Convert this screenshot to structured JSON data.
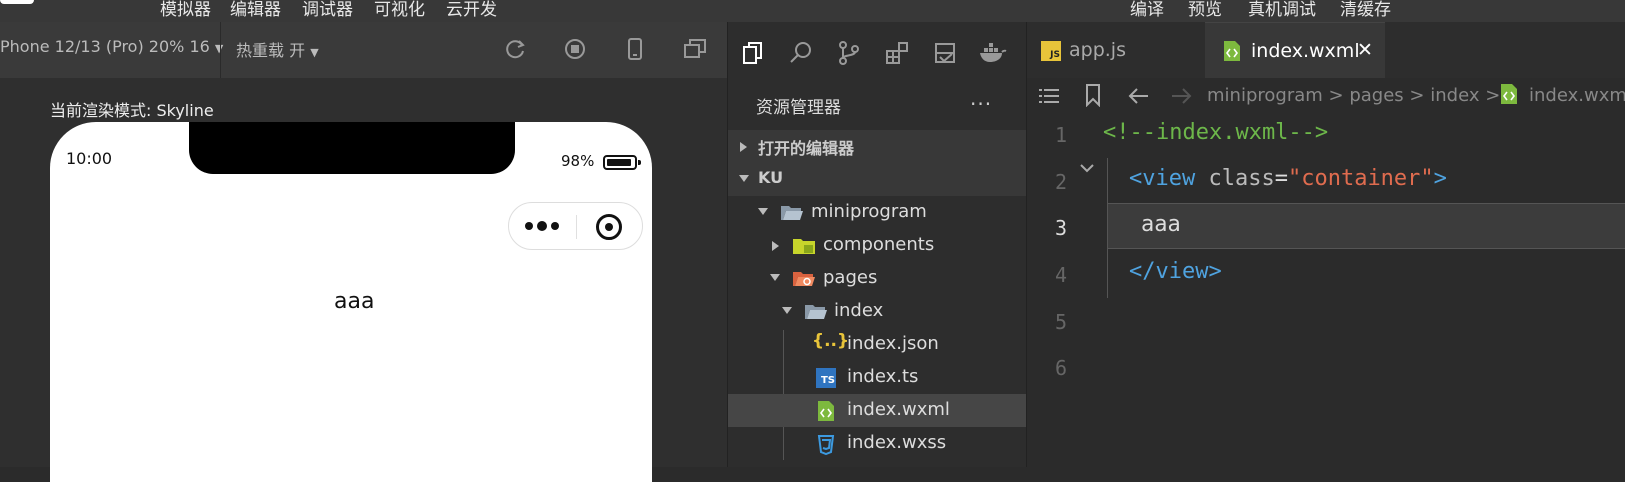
{
  "menubar": {
    "left_items": [
      "模拟器",
      "编辑器",
      "调试器",
      "可视化",
      "云开发"
    ],
    "right_items": [
      "编译",
      "预览",
      "真机调试",
      "清缓存"
    ]
  },
  "simulator_toolbar": {
    "device": "Phone 12/13 (Pro) 20% 16",
    "hot_reload": "热重载 开"
  },
  "render_mode": "当前渲染模式: Skyline",
  "phone": {
    "time": "10:00",
    "battery": "98%",
    "content": "aaa"
  },
  "explorer": {
    "title": "资源管理器",
    "more": "...",
    "open_editors": "打开的编辑器",
    "root": "KU",
    "tree": [
      {
        "label": "miniprogram",
        "icon": "folder-open-icon",
        "expanded": true
      },
      {
        "label": "components",
        "icon": "folder-components-icon",
        "expanded": false
      },
      {
        "label": "pages",
        "icon": "folder-pages-icon",
        "expanded": true
      },
      {
        "label": "index",
        "icon": "folder-open-icon",
        "expanded": true
      },
      {
        "label": "index.json",
        "icon": "json-file-icon"
      },
      {
        "label": "index.ts",
        "icon": "ts-file-icon"
      },
      {
        "label": "index.wxml",
        "icon": "wxml-file-icon",
        "selected": true
      },
      {
        "label": "index.wxss",
        "icon": "wxss-file-icon"
      }
    ]
  },
  "tabs": [
    {
      "label": "app.js",
      "active": false,
      "icon_text": "JS"
    },
    {
      "label": "index.wxml",
      "active": true,
      "close": "✕"
    }
  ],
  "breadcrumb": [
    "miniprogram",
    "pages",
    "index",
    "index.wxml"
  ],
  "breadcrumb_sep": ">",
  "code": {
    "line_numbers": [
      "1",
      "2",
      "3",
      "4",
      "5",
      "6"
    ],
    "comment": "<!--index.wxml-->",
    "open_tag_start": "<view",
    "attr_name": "class",
    "equals": "=",
    "attr_value": "\"container\"",
    "open_tag_end": ">",
    "text": "aaa",
    "close_tag": "</view>"
  },
  "colors": {
    "accent_green": "#6db74a",
    "tag_blue": "#4fa3e0",
    "string_orange": "#e06c4f"
  }
}
